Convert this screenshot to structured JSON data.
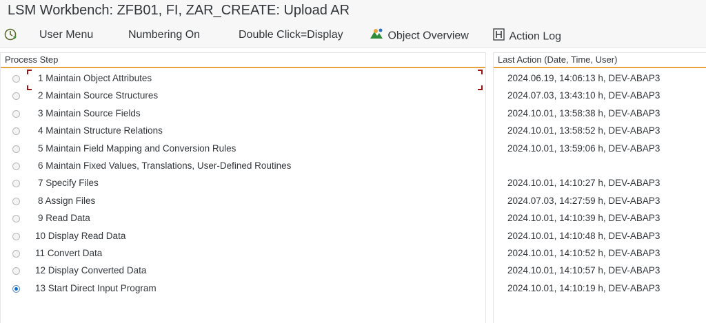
{
  "window": {
    "title": "LSM Workbench: ZFB01, FI, ZAR_CREATE: Upload AR"
  },
  "toolbar": {
    "execute_icon": "execute-clock-icon",
    "user_menu": "User Menu",
    "numbering_on": "Numbering On",
    "double_click": "Double Click=Display",
    "object_overview_icon": "object-overview-icon",
    "object_overview": "Object Overview",
    "action_log_icon": "action-log-h-icon",
    "action_log": "Action Log"
  },
  "colors": {
    "header_underline": "#e8a33a",
    "radio_selected": "#0a6ed1",
    "focus_frame": "#a01010"
  },
  "process": {
    "header": "Process Step",
    "selected_index": 12,
    "steps": [
      {
        "label": "1 Maintain Object Attributes"
      },
      {
        "label": "2 Maintain Source Structures"
      },
      {
        "label": "3 Maintain Source Fields"
      },
      {
        "label": "4 Maintain Structure Relations"
      },
      {
        "label": "5 Maintain Field Mapping and Conversion Rules"
      },
      {
        "label": "6 Maintain Fixed Values, Translations, User-Defined Routines"
      },
      {
        "label": "7 Specify Files"
      },
      {
        "label": "8 Assign Files"
      },
      {
        "label": "9 Read Data"
      },
      {
        "label": "10 Display Read Data"
      },
      {
        "label": "11 Convert Data"
      },
      {
        "label": "12 Display Converted Data"
      },
      {
        "label": "13 Start Direct Input Program"
      }
    ]
  },
  "last_action": {
    "header": "Last Action (Date, Time, User)",
    "entries": [
      "2024.06.19, 14:06:13 h, DEV-ABAP3",
      "2024.07.03, 13:43:10 h, DEV-ABAP3",
      "2024.10.01, 13:58:38 h, DEV-ABAP3",
      "2024.10.01, 13:58:52 h, DEV-ABAP3",
      "2024.10.01, 13:59:06 h, DEV-ABAP3",
      "",
      "2024.10.01, 14:10:27 h, DEV-ABAP3",
      "2024.07.03, 14:27:59 h, DEV-ABAP3",
      "2024.10.01, 14:10:39 h, DEV-ABAP3",
      "2024.10.01, 14:10:48 h, DEV-ABAP3",
      "2024.10.01, 14:10:52 h, DEV-ABAP3",
      "2024.10.01, 14:10:57 h, DEV-ABAP3",
      "2024.10.01, 14:10:19 h, DEV-ABAP3"
    ]
  }
}
